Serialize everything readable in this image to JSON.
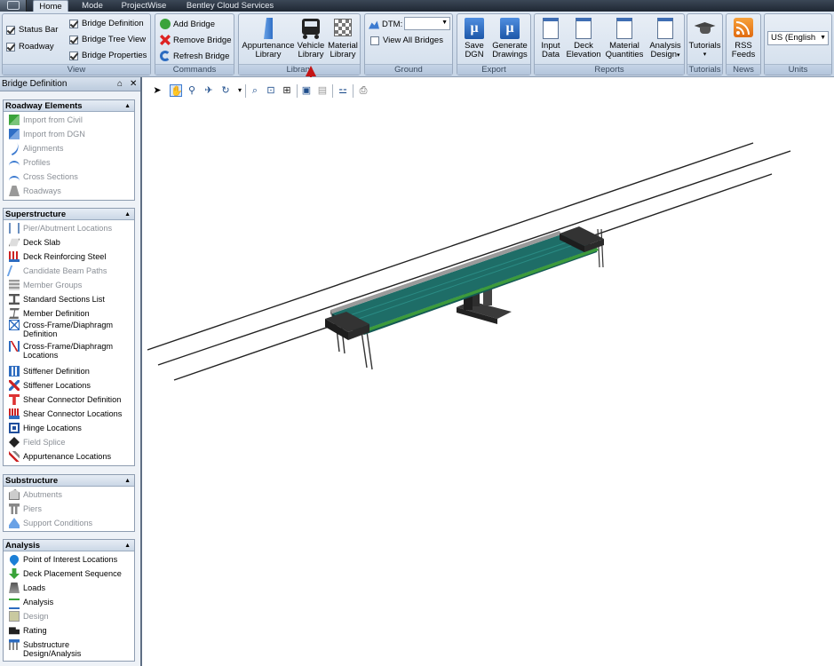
{
  "tabs": [
    {
      "label": "Home",
      "active": true
    },
    {
      "label": "Mode",
      "active": false
    },
    {
      "label": "ProjectWise",
      "active": false
    },
    {
      "label": "Bentley Cloud Services",
      "active": false
    }
  ],
  "ribbon": {
    "view": {
      "title": "View",
      "status_bar": "Status Bar",
      "roadway": "Roadway",
      "bridge_definition": "Bridge Definition",
      "bridge_tree_view": "Bridge Tree View",
      "bridge_properties": "Bridge Properties"
    },
    "commands": {
      "title": "Commands",
      "add_bridge": "Add Bridge",
      "remove_bridge": "Remove Bridge",
      "refresh_bridge": "Refresh Bridge"
    },
    "library": {
      "title": "Library",
      "appurtenance_1": "Appurtenance",
      "appurtenance_2": "Library",
      "vehicle_1": "Vehicle",
      "vehicle_2": "Library",
      "material_1": "Material",
      "material_2": "Library"
    },
    "ground": {
      "title": "Ground",
      "dtm_label": "DTM:",
      "dtm_value": "",
      "view_all_bridges": "View All Bridges"
    },
    "export": {
      "title": "Export",
      "save_1": "Save",
      "save_2": "DGN",
      "generate_1": "Generate",
      "generate_2": "Drawings"
    },
    "reports": {
      "title": "Reports",
      "input_1": "Input",
      "input_2": "Data",
      "deck_1": "Deck",
      "deck_2": "Elevation",
      "material_1": "Material",
      "material_2": "Quantities",
      "analysis_1": "Analysis",
      "analysis_2": "Design"
    },
    "tutorials": {
      "title": "Tutorials",
      "label": "Tutorials"
    },
    "news": {
      "title": "News",
      "rss_1": "RSS",
      "rss_2": "Feeds"
    },
    "units": {
      "title": "Units",
      "value": "US (English"
    }
  },
  "left_panel": {
    "title": "Bridge Definition",
    "pin": "⌂",
    "close": "✕",
    "sections": {
      "roadway": {
        "title": "Roadway Elements",
        "items": [
          "Import from Civil",
          "Import from DGN",
          "Alignments",
          "Profiles",
          "Cross Sections",
          "Roadways"
        ]
      },
      "superstructure": {
        "title": "Superstructure",
        "items": [
          "Pier/Abutment Locations",
          "Deck Slab",
          "Deck Reinforcing Steel",
          "Candidate Beam Paths",
          "Member Groups",
          "Standard Sections List",
          "Member Definition",
          "Cross-Frame/Diaphragm",
          "Definition",
          "Cross-Frame/Diaphragm",
          "Locations",
          "Stiffener Definition",
          "Stiffener Locations",
          "Shear Connector Definition",
          "Shear Connector Locations",
          "Hinge Locations",
          "Field Splice",
          "Appurtenance Locations"
        ]
      },
      "substructure": {
        "title": "Substructure",
        "items": [
          "Abutments",
          "Piers",
          "Support Conditions"
        ]
      },
      "analysis": {
        "title": "Analysis",
        "items": [
          "Point of Interest Locations",
          "Deck Placement Sequence",
          "Loads",
          "Analysis",
          "Design",
          "Rating",
          "Substructure",
          "Design/Analysis"
        ]
      }
    }
  }
}
